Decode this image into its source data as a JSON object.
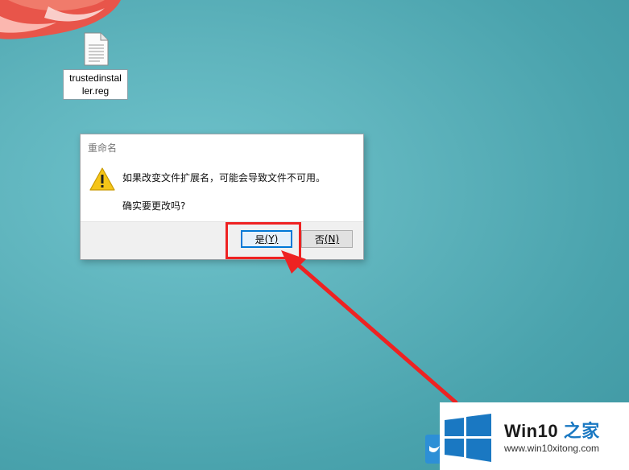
{
  "desktop": {
    "file": {
      "name_line1": "trustedinstal",
      "name_line2": "ler.reg",
      "icon": "document-icon"
    }
  },
  "dialog": {
    "title": "重命名",
    "icon": "warning-icon",
    "message": "如果改变文件扩展名，可能会导致文件不可用。",
    "confirm": "确实要更改吗?",
    "yes_button": {
      "label": "是",
      "accel": "(Y)"
    },
    "no_button": {
      "label": "否",
      "accel": "(N)"
    }
  },
  "watermark": {
    "title_part1": "Win10",
    "title_part2": " 之家",
    "url": "www.win10xitong.com",
    "logo": "windows-logo-icon"
  },
  "colors": {
    "highlight": "#ee2222",
    "focus": "#0078d7",
    "brand": "#1a78c2"
  }
}
